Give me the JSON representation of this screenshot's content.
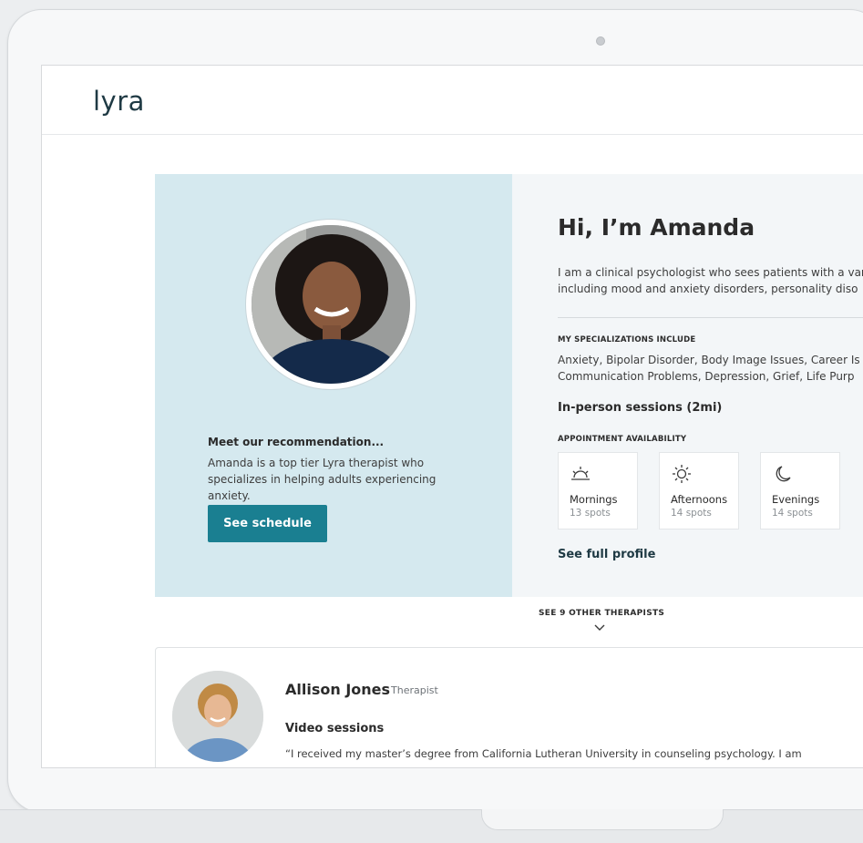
{
  "brand": {
    "logo": "lyra"
  },
  "recommendation": {
    "title": "Meet our recommendation...",
    "description": "Amanda is a top tier Lyra therapist who specializes in helping adults experiencing anxiety.",
    "button": "See schedule"
  },
  "therapist": {
    "greeting": "Hi, I’m Amanda",
    "bio_line1": "I am a clinical psychologist who sees patients with a var",
    "bio_line2": "including mood and anxiety disorders, personality diso",
    "spec_label": "MY SPECIALIZATIONS INCLUDE",
    "spec_line1": "Anxiety, Bipolar Disorder, Body Image Issues, Career Is",
    "spec_line2": "Communication Problems, Depression, Grief, Life Purp",
    "session_type": "In-person sessions (2mi)",
    "availability_label": "APPOINTMENT AVAILABILITY",
    "slots": [
      {
        "name": "Mornings",
        "spots": "13 spots",
        "icon": "sunrise-icon"
      },
      {
        "name": "Afternoons",
        "spots": "14 spots",
        "icon": "sun-icon"
      },
      {
        "name": "Evenings",
        "spots": "14 spots",
        "icon": "moon-icon"
      }
    ],
    "full_profile": "See full profile"
  },
  "others": {
    "label": "SEE 9 OTHER THERAPISTS"
  },
  "card": {
    "name": "Allison Jones",
    "role": "Therapist",
    "session": "Video sessions",
    "quote": "“I received my master’s degree from California Lutheran University in counseling psychology. I am"
  },
  "colors": {
    "accent": "#1a7f91",
    "hero_left": "#d5e9ef",
    "hero_right": "#f3f6f8"
  }
}
